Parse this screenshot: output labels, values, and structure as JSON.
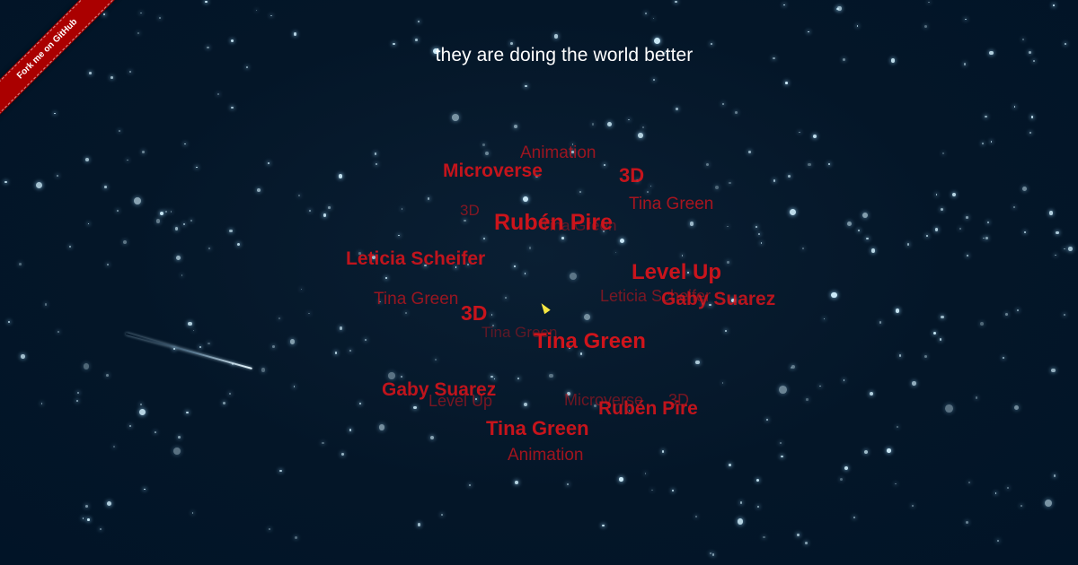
{
  "headline": "they are doing the world better",
  "ribbon": {
    "label": "Fork me on GitHub"
  },
  "colors": {
    "background": "#011627",
    "tag": "#d4141b",
    "headline": "#ffffff",
    "ribbon": "#aa0000",
    "star": "#cfeefc"
  },
  "tag_cloud": [
    {
      "text": "Animation"
    },
    {
      "text": "Microverse"
    },
    {
      "text": "3D"
    },
    {
      "text": "Tina Green"
    },
    {
      "text": "3D"
    },
    {
      "text": "Rubén Pire"
    },
    {
      "text": "Tina Green"
    },
    {
      "text": "Leticia Scheifer"
    },
    {
      "text": "Level Up"
    },
    {
      "text": "Tina Green"
    },
    {
      "text": "Leticia Scheifer"
    },
    {
      "text": "Gaby Suarez"
    },
    {
      "text": "3D"
    },
    {
      "text": "Tina Green"
    },
    {
      "text": "Tina Green"
    },
    {
      "text": "Gaby Suarez"
    },
    {
      "text": "Level Up"
    },
    {
      "text": "Microverse"
    },
    {
      "text": "3D"
    },
    {
      "text": "Rubén Pire"
    },
    {
      "text": "Tina Green"
    },
    {
      "text": "Animation"
    }
  ]
}
